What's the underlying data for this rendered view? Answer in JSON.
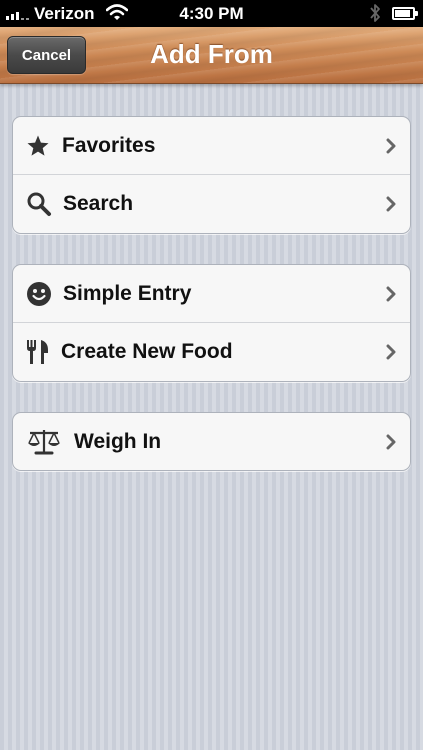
{
  "status_bar": {
    "carrier": "Verizon",
    "time": "4:30 PM",
    "icons": [
      "signal-icon",
      "wifi-icon",
      "bluetooth-icon",
      "battery-icon"
    ]
  },
  "nav_bar": {
    "cancel_label": "Cancel",
    "title": "Add From"
  },
  "groups": [
    {
      "items": [
        {
          "label": "Favorites",
          "icon": "star-icon"
        },
        {
          "label": "Search",
          "icon": "magnifier-icon"
        }
      ]
    },
    {
      "items": [
        {
          "label": "Simple Entry",
          "icon": "smiley-icon"
        },
        {
          "label": "Create New Food",
          "icon": "fork-knife-icon"
        }
      ]
    },
    {
      "items": [
        {
          "label": "Weigh In",
          "icon": "scale-icon"
        }
      ]
    }
  ],
  "colors": {
    "status_bar": "#000000",
    "nav_wood": "#cf8c58",
    "cancel_button": "#4a4a4a",
    "background_stripes": "#d4d8e0",
    "cell_background": "#f7f7f7",
    "label_text": "#111111",
    "chevron": "#666666"
  }
}
